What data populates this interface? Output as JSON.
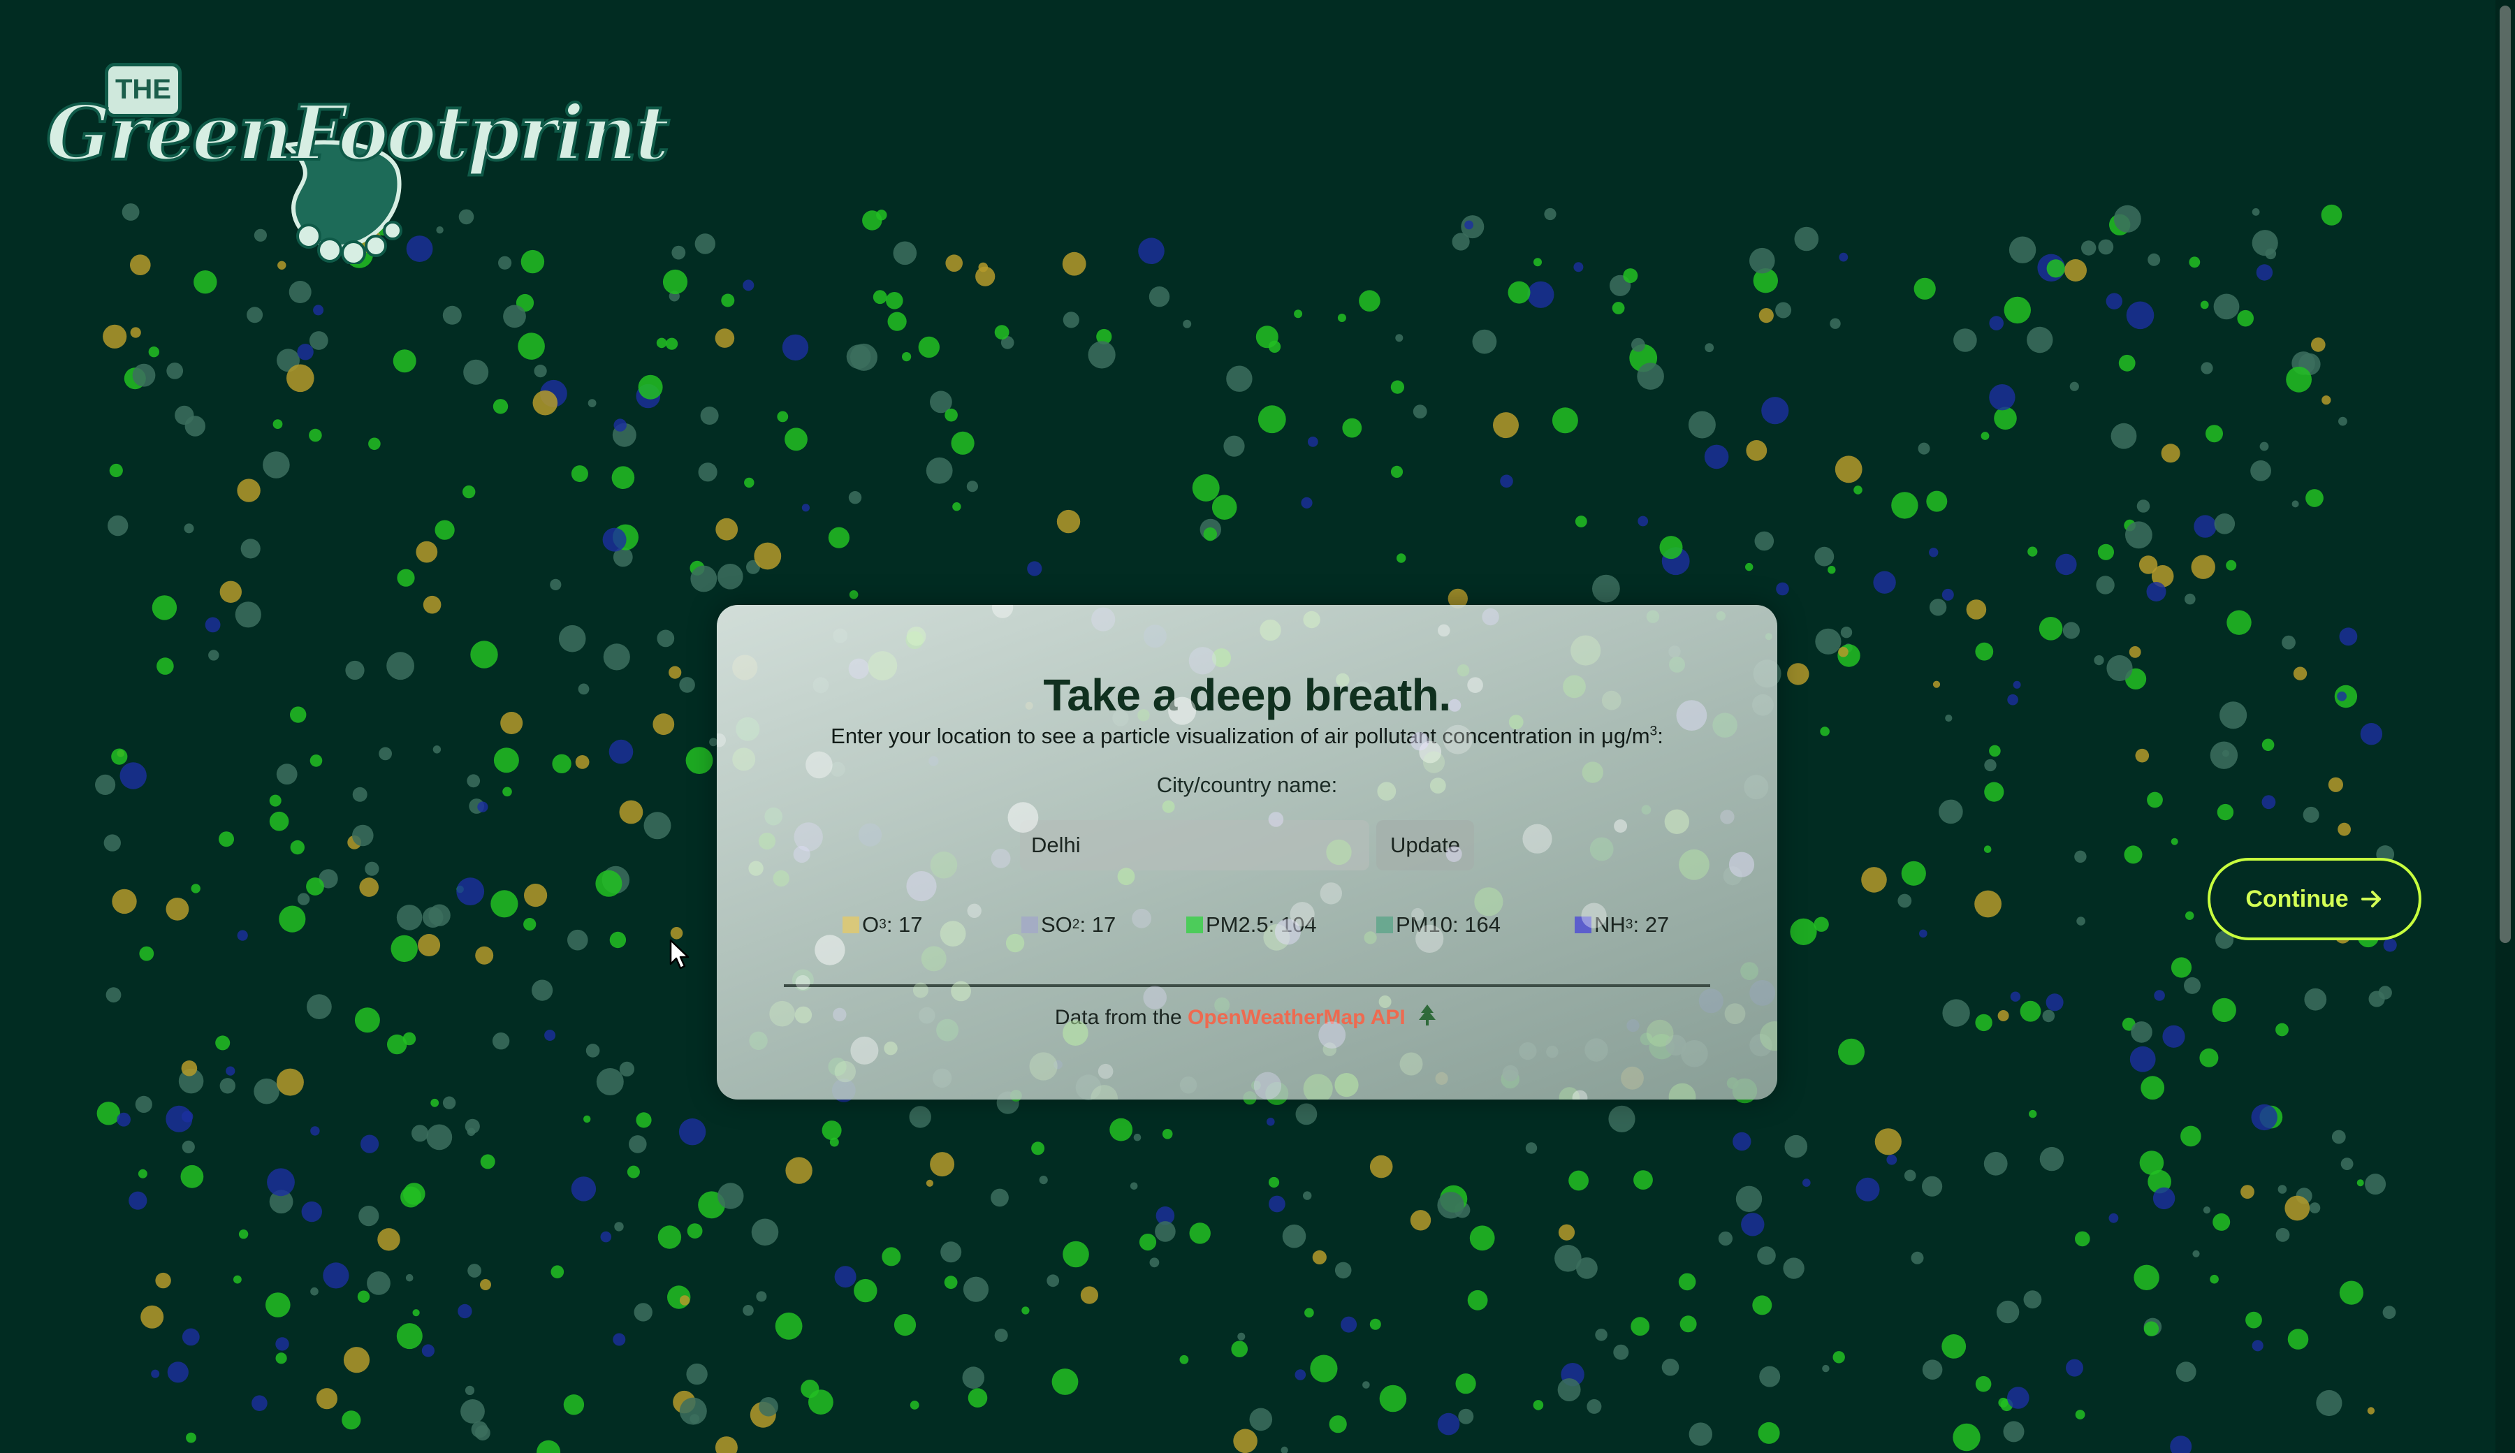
{
  "logo": {
    "the": "THE",
    "name": "GreenFootprint",
    "foot_icon": "footprint-icon",
    "colors": {
      "fill": "#d7eee3",
      "outline": "#0f5a48",
      "foot": "#1d6b58"
    }
  },
  "card": {
    "title": "Take a deep breath.",
    "subtitle_main": "Enter your location to see a particle visualization of air pollutant concentration in μg/m",
    "subtitle_sup": "3",
    "subtitle_end": ":",
    "input_label": "City/country name:",
    "city_value": "Delhi",
    "update_label": "Update",
    "source_prefix": "Data from the ",
    "source_link": "OpenWeatherMap API",
    "source_icon": "tree-icon"
  },
  "pollutants": [
    {
      "base": "O",
      "sup": "3",
      "text": ": 17",
      "color": "#d9c87a"
    },
    {
      "base": "SO",
      "sup": "2",
      "text": ": 17",
      "color": "#a4acc4"
    },
    {
      "base": "PM2.5",
      "sup": "",
      "text": ": 104",
      "color": "#4ccc5a"
    },
    {
      "base": "PM10",
      "sup": "",
      "text": ": 164",
      "color": "#6aa890"
    },
    {
      "base": "NH",
      "sup": "3",
      "text": ": 27",
      "color": "#5c5ecc"
    }
  ],
  "continue": {
    "label": "Continue",
    "icon": "arrow-right-icon"
  },
  "colors": {
    "background": "#012c22",
    "accent": "#c8ff3e",
    "link": "#ee6a50",
    "particle_green": "#22c022",
    "particle_blue": "#1c2fa0",
    "particle_gold": "#b49a2a",
    "particle_teal": "#3c6e5e"
  }
}
